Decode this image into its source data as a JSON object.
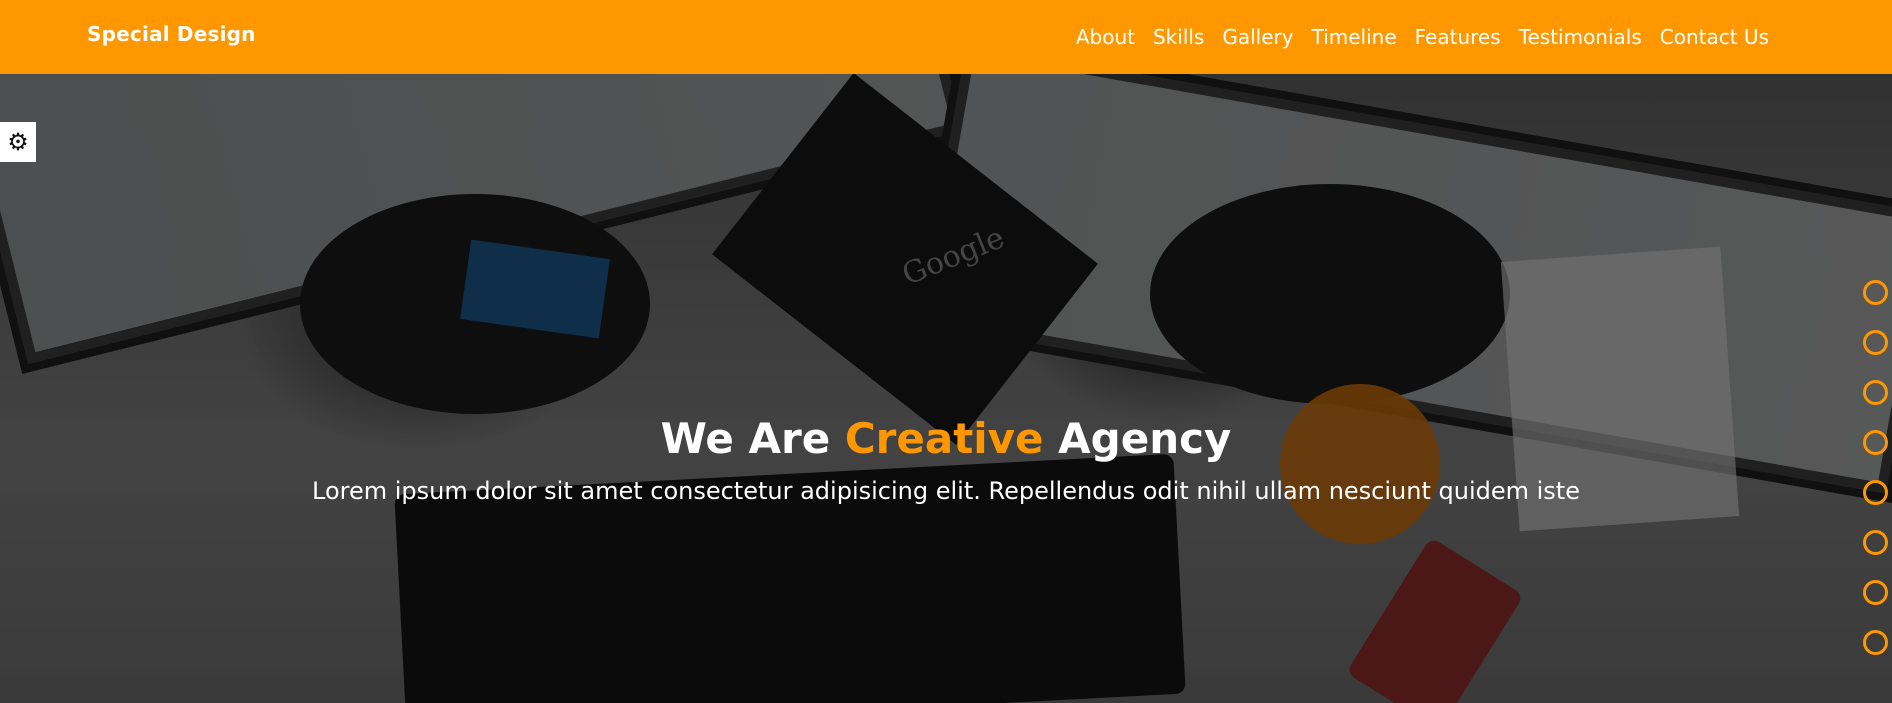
{
  "header": {
    "logo": "Special Design",
    "nav": [
      "About",
      "Skills",
      "Gallery",
      "Timeline",
      "Features",
      "Testimonials",
      "Contact Us"
    ]
  },
  "hero": {
    "title_prefix": "We Are",
    "title_accent": "Creative",
    "title_suffix": "Agency",
    "subtitle": "Lorem ipsum dolor sit amet consectetur adipisicing elit. Repellendus odit nihil ullam nesciunt quidem iste",
    "book_label": "Google"
  },
  "settings": {
    "icon": "gear-icon"
  },
  "bullets": {
    "count": 8
  },
  "colors": {
    "accent": "#ff9800",
    "white": "#ffffff"
  }
}
